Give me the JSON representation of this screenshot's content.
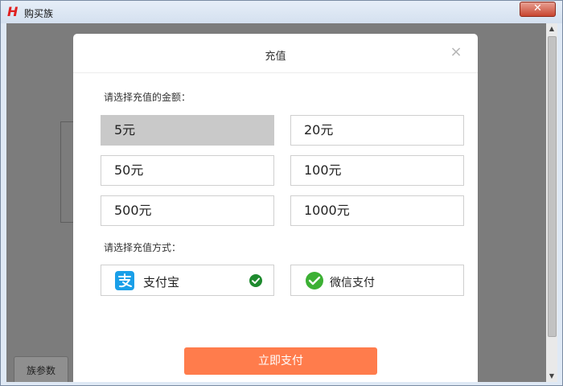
{
  "window": {
    "title": "购买族",
    "close_label": "✕"
  },
  "background": {
    "tab_label": "族参数"
  },
  "modal": {
    "title": "充值",
    "close_symbol": "×",
    "amount_prompt": "请选择充值的金额：",
    "amounts": [
      {
        "label": "5元",
        "selected": true
      },
      {
        "label": "20元",
        "selected": false
      },
      {
        "label": "50元",
        "selected": false
      },
      {
        "label": "100元",
        "selected": false
      },
      {
        "label": "500元",
        "selected": false
      },
      {
        "label": "1000元",
        "selected": false
      }
    ],
    "method_prompt": "请选择充值方式：",
    "methods": [
      {
        "label": "支付宝",
        "icon": "alipay-icon",
        "selected": true
      },
      {
        "label": "微信支付",
        "icon": "wechat-pay-icon",
        "selected": false
      }
    ],
    "submit_label": "立即支付"
  },
  "colors": {
    "accent": "#ff7c4c",
    "alipay": "#1a9fe8",
    "wechat": "#3cb034",
    "check": "#1e8a2e",
    "selected_amount": "#c9c9c9"
  }
}
